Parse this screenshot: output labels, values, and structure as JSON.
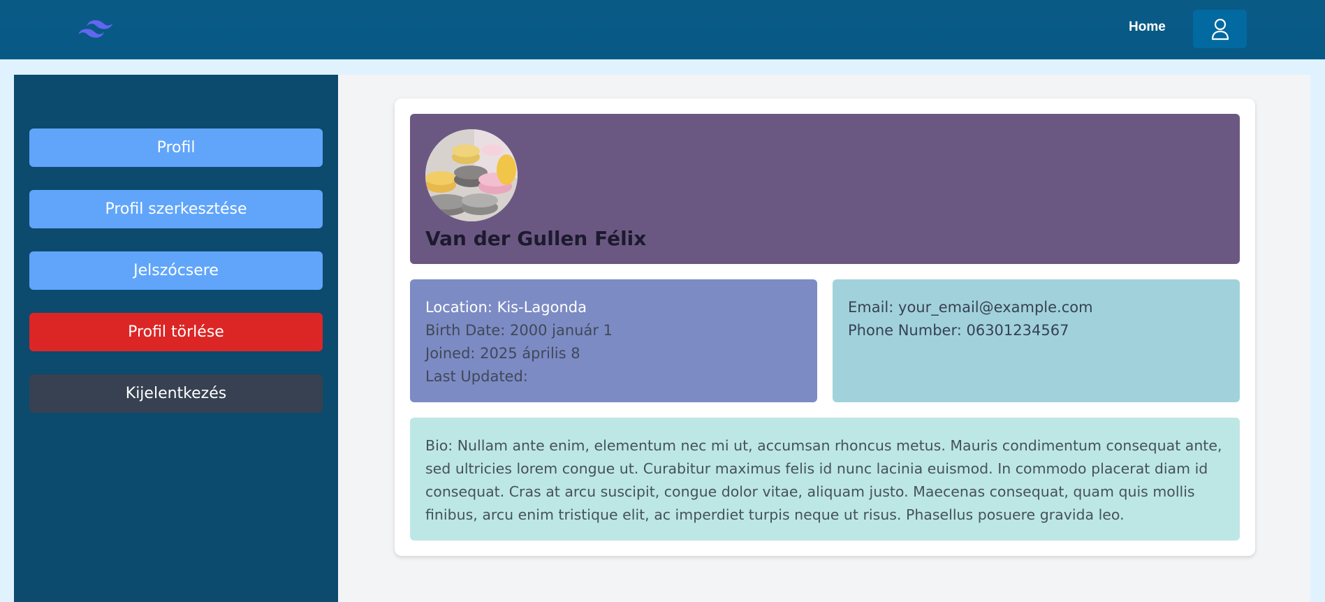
{
  "nav": {
    "home_label": "Home",
    "user_icon": "user-icon",
    "logo_icon": "wave-logo-icon"
  },
  "sidebar": {
    "items": [
      {
        "label": "Profil",
        "color": "#60a5fa"
      },
      {
        "label": "Profil szerkesztése",
        "color": "#60a5fa"
      },
      {
        "label": "Jelszócsere",
        "color": "#60a5fa"
      },
      {
        "label": "Profil törlése",
        "color": "#dc2626"
      },
      {
        "label": "Kijelentkezés",
        "color": "#374151"
      }
    ]
  },
  "profile": {
    "name": "Van der Gullen Félix",
    "location": "Location: Kis-Lagonda",
    "birth_date": "Birth Date: 2000 január 1",
    "joined": "Joined: 2025 április 8",
    "last_updated": "Last Updated:",
    "email": "Email: your_email@example.com",
    "phone": "Phone Number: 06301234567",
    "bio": "Bio: Nullam ante enim, elementum nec mi ut, accumsan rhoncus metus. Mauris condimentum consequat ante, sed ultricies lorem congue ut. Curabitur maximus felis id nunc lacinia euismod. In commodo placerat diam id consequat. Cras at arcu suscipit, congue dolor vitae, aliquam justo. Maecenas consequat, quam quis mollis finibus, arcu enim tristique elit, ac imperdiet turpis neque ut risus. Phasellus posuere gravida leo."
  },
  "colors": {
    "topbar": "#075985",
    "sidebar": "#0c4a6e",
    "header_panel": "#6b5882",
    "info_left": "#7c8bc4",
    "info_right": "#a1d2dc",
    "bio_panel": "#bde7e5"
  }
}
